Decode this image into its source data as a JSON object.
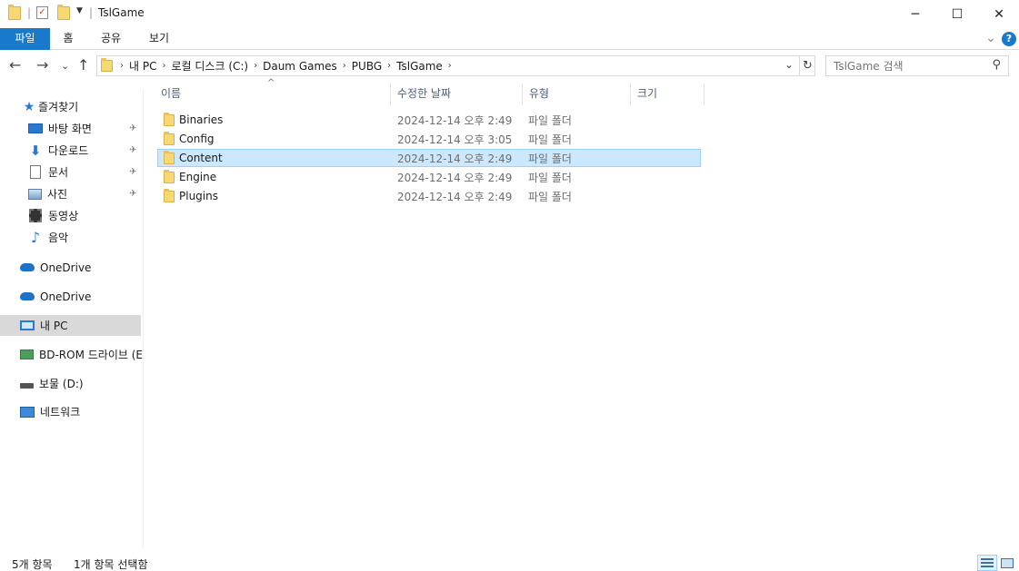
{
  "window": {
    "title": "TslGame",
    "minimize_glyph": "─",
    "maximize_glyph": "☐",
    "close_glyph": "✕"
  },
  "ribbon": {
    "tabs": [
      {
        "label": "파일"
      },
      {
        "label": "홈"
      },
      {
        "label": "공유"
      },
      {
        "label": "보기"
      }
    ],
    "expand_glyph": "⌄",
    "help_glyph": "?"
  },
  "nav": {
    "back_glyph": "←",
    "forward_glyph": "→",
    "recent_glyph": "⌄",
    "up_glyph": "↑"
  },
  "address": {
    "breadcrumbs": [
      "내 PC",
      "로컬 디스크 (C:)",
      "Daum Games",
      "PUBG",
      "TslGame"
    ],
    "dropdown_glyph": "⌄",
    "refresh_glyph": "↻"
  },
  "search": {
    "placeholder": "TslGame 검색",
    "icon_glyph": "⚲"
  },
  "sidebar": {
    "items": [
      {
        "label": "즐겨찾기",
        "icon": "star-icon",
        "pinned": false
      },
      {
        "label": "바탕 화면",
        "icon": "desktop-icon",
        "pinned": true
      },
      {
        "label": "다운로드",
        "icon": "download-icon",
        "pinned": true
      },
      {
        "label": "문서",
        "icon": "document-icon",
        "pinned": true
      },
      {
        "label": "사진",
        "icon": "picture-icon",
        "pinned": true
      },
      {
        "label": "동영상",
        "icon": "video-icon",
        "pinned": false
      },
      {
        "label": "음악",
        "icon": "music-icon",
        "pinned": false
      },
      {
        "label": "OneDrive",
        "icon": "onedrive-icon"
      },
      {
        "label": "OneDrive",
        "icon": "onedrive-icon"
      },
      {
        "label": "내 PC",
        "icon": "pc-icon",
        "selected": true
      },
      {
        "label": "BD-ROM 드라이브 (E",
        "icon": "disc-drive-icon"
      },
      {
        "label": "보물 (D:)",
        "icon": "drive-icon"
      },
      {
        "label": "네트워크",
        "icon": "network-icon"
      }
    ],
    "pin_glyph": "📌"
  },
  "columns": {
    "name": "이름",
    "modified": "수정한 날짜",
    "type": "유형",
    "size": "크기",
    "sort_glyph": "^"
  },
  "files": [
    {
      "name": "Binaries",
      "modified": "2024-12-14 오후 2:49",
      "type": "파일 폴더",
      "selected": false
    },
    {
      "name": "Config",
      "modified": "2024-12-14 오후 3:05",
      "type": "파일 폴더",
      "selected": false
    },
    {
      "name": "Content",
      "modified": "2024-12-14 오후 2:49",
      "type": "파일 폴더",
      "selected": true
    },
    {
      "name": "Engine",
      "modified": "2024-12-14 오후 2:49",
      "type": "파일 폴더",
      "selected": false
    },
    {
      "name": "Plugins",
      "modified": "2024-12-14 오후 2:49",
      "type": "파일 폴더",
      "selected": false
    }
  ],
  "status": {
    "item_count": "5개 항목",
    "selection": "1개 항목 선택함"
  },
  "colors": {
    "accent": "#1979ca",
    "selection_bg": "#cce8ff",
    "selection_border": "#99d1ff",
    "folder": "#f8d775"
  }
}
